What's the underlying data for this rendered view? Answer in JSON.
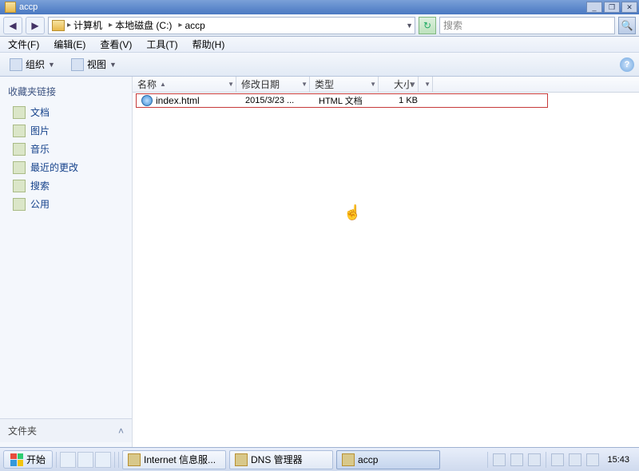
{
  "window": {
    "title": "accp"
  },
  "nav": {
    "segments": [
      {
        "label": "计算机",
        "icon": "computer"
      },
      {
        "label": "本地磁盘 (C:)",
        "icon": "drive"
      },
      {
        "label": "accp",
        "icon": ""
      }
    ],
    "search_placeholder": "搜索"
  },
  "menu": {
    "file": "文件(F)",
    "edit": "编辑(E)",
    "view": "查看(V)",
    "tools": "工具(T)",
    "help": "帮助(H)"
  },
  "toolbar": {
    "organize": "组织",
    "views": "视图"
  },
  "sidebar": {
    "fav_links_header": "收藏夹链接",
    "items": [
      {
        "label": "文档"
      },
      {
        "label": "图片"
      },
      {
        "label": "音乐"
      },
      {
        "label": "最近的更改"
      },
      {
        "label": "搜索"
      },
      {
        "label": "公用"
      }
    ],
    "folders_header": "文件夹"
  },
  "columns": {
    "name": "名称",
    "date_modified": "修改日期",
    "type": "类型",
    "size": "大小"
  },
  "files": [
    {
      "name": "index.html",
      "date": "2015/3/23 ...",
      "type": "HTML 文档",
      "size": "1 KB"
    }
  ],
  "taskbar": {
    "start": "开始",
    "tasks": [
      {
        "label": "Internet 信息服...",
        "icon": "iis"
      },
      {
        "label": "DNS 管理器",
        "icon": "dns"
      },
      {
        "label": "accp",
        "icon": "folder",
        "active": true
      }
    ],
    "clock": "15:43"
  }
}
